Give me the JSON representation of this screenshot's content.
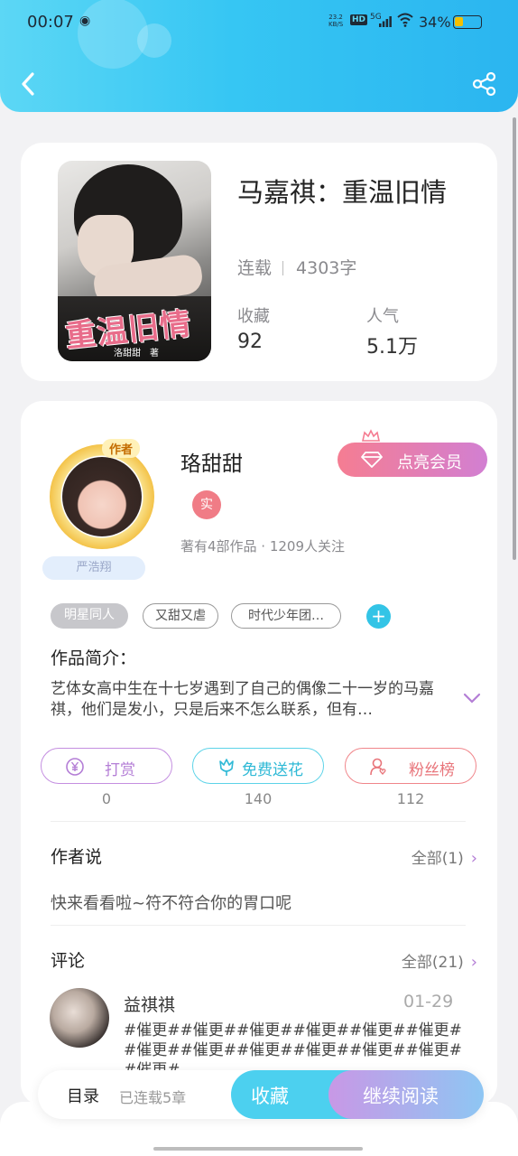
{
  "status_bar": {
    "time": "00:07",
    "net_speed_value": "23.2",
    "net_speed_unit": "KB/S",
    "hd": "HD",
    "signal": "5G",
    "battery_pct": "34%",
    "battery_level": 0.34
  },
  "book": {
    "title": "马嘉祺：重温旧情",
    "status": "连载",
    "word_count": "4303字",
    "favorites_label": "收藏",
    "favorites_value": "92",
    "popularity_label": "人气",
    "popularity_value": "5.1万",
    "cover_title": "重温旧情",
    "cover_author": "洛甜甜　著"
  },
  "author": {
    "name": "珞甜甜",
    "avatar_tag": "作者",
    "avatar_name": "严浩翔",
    "verified": "实",
    "meta": "著有4部作品 · 1209人关注",
    "vip_button": "点亮会员"
  },
  "tags": [
    "明星同人",
    "又甜又虐",
    "时代少年团…"
  ],
  "intro": {
    "label": "作品简介：",
    "text": "艺体女高中生在十七岁遇到了自己的偶像二十一岁的马嘉祺，他们是发小，只是后来不怎么联系，但有…"
  },
  "actions": [
    {
      "label": "打赏",
      "count": "0",
      "color": "#b47ed6"
    },
    {
      "label": "免费送花",
      "count": "140",
      "color": "#2fb9d6"
    },
    {
      "label": "粉丝榜",
      "count": "112",
      "color": "#e8747a"
    }
  ],
  "author_says": {
    "label": "作者说",
    "all_link": "全部(1)",
    "text": "快来看看啦~符不符合你的胃口呢"
  },
  "comments": {
    "label": "评论",
    "all_link": "全部(21)",
    "items": [
      {
        "user": "益祺祺",
        "date": "01-29",
        "text": "#催更##催更##催更##催更##催更##催更##催更##催更##催更##催更##催更##催更##催更#"
      }
    ]
  },
  "bottom_bar": {
    "toc": "目录",
    "chapters": "已连载5章",
    "collect": "收藏",
    "continue_reading": "继续阅读"
  },
  "icons": [
    "back-icon",
    "share-icon",
    "crown-icon",
    "diamond-icon",
    "yen-icon",
    "flower-icon",
    "fan-icon",
    "chevron-down-icon",
    "chevron-right-icon",
    "plus-icon"
  ]
}
